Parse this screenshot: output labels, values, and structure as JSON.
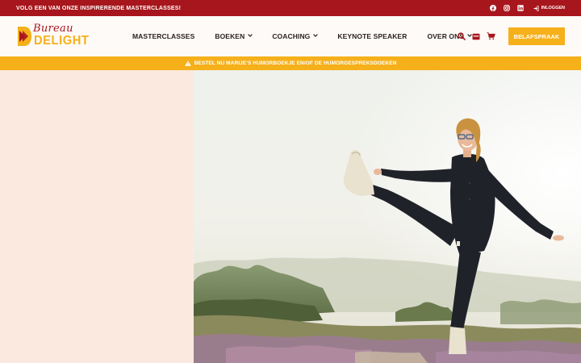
{
  "topbar": {
    "promo": "VOLG EEN VAN ONZE INSPIRERENDE MASTERCLASSES!",
    "login_label": "INLOGGEN",
    "social": [
      "facebook-icon",
      "instagram-icon",
      "linkedin-icon"
    ]
  },
  "logo": {
    "script": "Bureau",
    "brand": "DELIGHT"
  },
  "nav": {
    "items": [
      {
        "label": "MASTERCLASSES",
        "dropdown": false
      },
      {
        "label": "BOEKEN",
        "dropdown": true
      },
      {
        "label": "COACHING",
        "dropdown": true
      },
      {
        "label": "KEYNOTE SPEAKER",
        "dropdown": false
      },
      {
        "label": "OVER ONS",
        "dropdown": true
      }
    ],
    "chevron": "⌄"
  },
  "header_icons": [
    "search-icon",
    "inbox-icon",
    "cart-icon"
  ],
  "cta": {
    "label": "BELAFSPRAAK"
  },
  "notice": {
    "text": "BESTEL NU MARIJE'S HUMORBOEKJE EN/OF DE HUMORGESPREKSDOEKEN"
  },
  "colors": {
    "brand_red": "#a7161c",
    "brand_yellow": "#f5b01a",
    "hero_left_bg": "#fbe9df",
    "nav_text": "#2a1e1e"
  }
}
